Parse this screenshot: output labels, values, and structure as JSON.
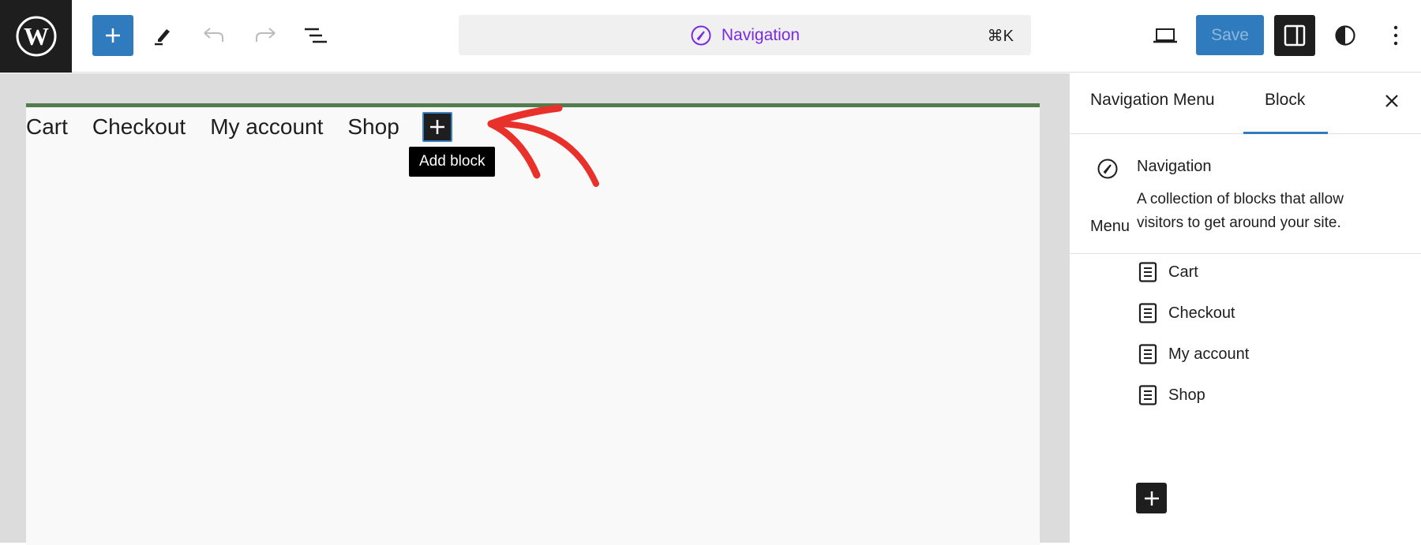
{
  "header": {
    "logo_icon": "wordpress-logo-icon",
    "toolbar": {
      "inserter_icon": "plus-icon",
      "tools_icon": "pencil-icon",
      "undo_icon": "undo-icon",
      "redo_icon": "redo-icon",
      "list_view_icon": "list-view-icon"
    },
    "command_bar": {
      "icon": "compass-icon",
      "label": "Navigation",
      "shortcut": "⌘K"
    },
    "right": {
      "preview_icon": "laptop-icon",
      "save_label": "Save",
      "sidebar_toggle_icon": "sidebar-icon",
      "styles_icon": "contrast-icon",
      "more_icon": "more-vertical-icon"
    }
  },
  "canvas": {
    "nav_items": [
      "Cart",
      "Checkout",
      "My account",
      "Shop"
    ],
    "add_block_tooltip": "Add block",
    "accent_color": "#527b4e",
    "annotation": "red-arrow"
  },
  "sidebar": {
    "tabs": [
      {
        "label": "Navigation Menu",
        "active": false
      },
      {
        "label": "Block",
        "active": true
      }
    ],
    "close_icon": "close-icon",
    "block_card": {
      "title": "Navigation",
      "description": "A collection of blocks that allow visitors to get around your site."
    },
    "menu": {
      "label": "Menu",
      "items": [
        {
          "label": "Cart",
          "icon": "page-icon"
        },
        {
          "label": "Checkout",
          "icon": "page-icon"
        },
        {
          "label": "My account",
          "icon": "page-icon"
        },
        {
          "label": "Shop",
          "icon": "page-icon"
        }
      ],
      "add_icon": "plus-icon"
    }
  }
}
